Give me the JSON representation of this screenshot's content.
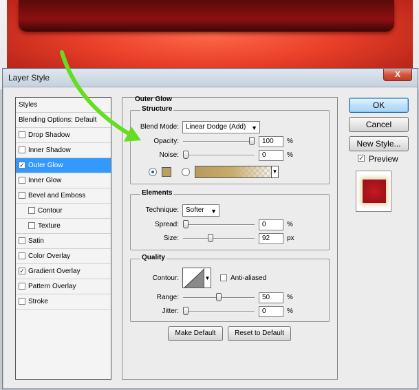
{
  "window": {
    "title": "Layer Style",
    "close_glyph": "X"
  },
  "styles_list": {
    "header": "Styles",
    "items": [
      {
        "label": "Blending Options: Default",
        "type": "plain"
      },
      {
        "label": "Drop Shadow",
        "checked": false
      },
      {
        "label": "Inner Shadow",
        "checked": false
      },
      {
        "label": "Outer Glow",
        "checked": true,
        "selected": true
      },
      {
        "label": "Inner Glow",
        "checked": false
      },
      {
        "label": "Bevel and Emboss",
        "checked": false
      },
      {
        "label": "Contour",
        "checked": false,
        "indent": true
      },
      {
        "label": "Texture",
        "checked": false,
        "indent": true
      },
      {
        "label": "Satin",
        "checked": false
      },
      {
        "label": "Color Overlay",
        "checked": false
      },
      {
        "label": "Gradient Overlay",
        "checked": true
      },
      {
        "label": "Pattern Overlay",
        "checked": false
      },
      {
        "label": "Stroke",
        "checked": false
      }
    ]
  },
  "panel": {
    "title": "Outer Glow",
    "structure": {
      "title": "Structure",
      "blend_mode_label": "Blend Mode:",
      "blend_mode_value": "Linear Dodge (Add)",
      "opacity_label": "Opacity:",
      "opacity_value": "100",
      "opacity_level": 1.0,
      "noise_label": "Noise:",
      "noise_value": "0",
      "noise_level": 0.0,
      "color_swatch": "#b8a060",
      "percent": "%"
    },
    "elements": {
      "title": "Elements",
      "technique_label": "Technique:",
      "technique_value": "Softer",
      "spread_label": "Spread:",
      "spread_value": "0",
      "spread_level": 0.0,
      "size_label": "Size:",
      "size_value": "92",
      "size_level": 0.37,
      "percent": "%",
      "px": "px"
    },
    "quality": {
      "title": "Quality",
      "contour_label": "Contour:",
      "anti_aliased_label": "Anti-aliased",
      "anti_aliased": false,
      "range_label": "Range:",
      "range_value": "50",
      "range_level": 0.5,
      "jitter_label": "Jitter:",
      "jitter_value": "0",
      "jitter_level": 0.0,
      "percent": "%"
    },
    "make_default": "Make Default",
    "reset_default": "Reset to Default"
  },
  "side_buttons": {
    "ok": "OK",
    "cancel": "Cancel",
    "new_style": "New Style...",
    "preview_label": "Preview",
    "preview_checked": true
  },
  "colors": {
    "selection": "#3399ff",
    "annotation_arrow": "#66dd22",
    "preview_fill": "#b3161e",
    "preview_glow": "#e9d5a8"
  }
}
